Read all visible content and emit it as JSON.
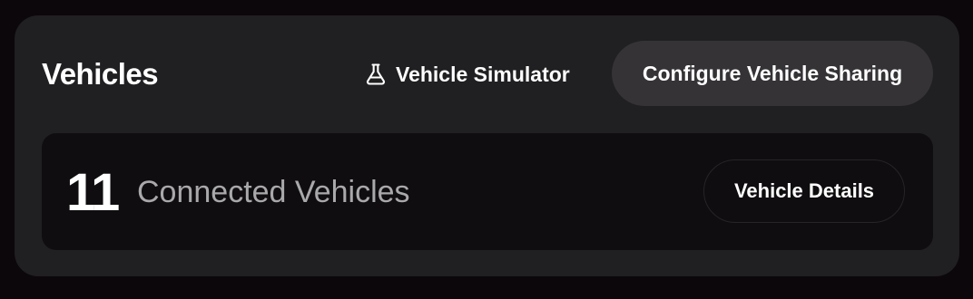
{
  "header": {
    "title": "Vehicles",
    "simulator_label": "Vehicle Simulator",
    "simulator_icon": "flask-icon",
    "configure_label": "Configure Vehicle Sharing"
  },
  "stats": {
    "count": "11",
    "count_label": "Connected Vehicles",
    "details_label": "Vehicle Details"
  },
  "colors": {
    "page_background": "#0b070b",
    "card_background": "#201f21",
    "panel_background": "#0f0d0f",
    "secondary_button": "#353336",
    "muted_text": "#a9a8aa"
  }
}
